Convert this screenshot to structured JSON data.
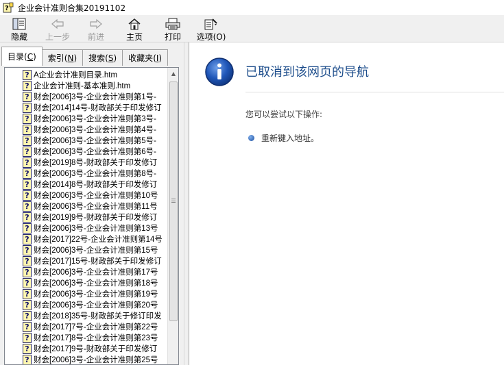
{
  "window": {
    "title": "企业会计准则合集20191102"
  },
  "toolbar": {
    "buttons": [
      {
        "label": "隐藏",
        "icon": "hide-pane-icon",
        "enabled": true
      },
      {
        "label": "上一步",
        "icon": "back-arrow-icon",
        "enabled": false
      },
      {
        "label": "前进",
        "icon": "forward-arrow-icon",
        "enabled": false
      },
      {
        "label": "主页",
        "icon": "home-icon",
        "enabled": true
      },
      {
        "label": "打印",
        "icon": "printer-icon",
        "enabled": true
      },
      {
        "label": "选项(O)",
        "icon": "options-icon",
        "enabled": true
      }
    ]
  },
  "tabs": [
    {
      "label": "目录",
      "key": "C"
    },
    {
      "label": "索引",
      "key": "N"
    },
    {
      "label": "搜索",
      "key": "S"
    },
    {
      "label": "收藏夹",
      "key": "I"
    }
  ],
  "tree": {
    "items": [
      "A企业会计准则目录.htm",
      "企业会计准则-基本准则.htm",
      "财会[2006]3号-企业会计准则第1号-",
      "财会[2014]14号-财政部关于印发修订",
      "财会[2006]3号-企业会计准则第3号-",
      "财会[2006]3号-企业会计准则第4号-",
      "财会[2006]3号-企业会计准则第5号-",
      "财会[2006]3号-企业会计准则第6号-",
      "财会[2019]8号-财政部关于印发修订",
      "财会[2006]3号-企业会计准则第8号-",
      "财会[2014]8号-财政部关于印发修订",
      "财会[2006]3号-企业会计准则第10号",
      "财会[2006]3号-企业会计准则第11号",
      "财会[2019]9号-财政部关于印发修订",
      "财会[2006]3号-企业会计准则第13号",
      "财会[2017]22号-企业会计准则第14号",
      "财会[2006]3号-企业会计准则第15号",
      "财会[2017]15号-财政部关于印发修订",
      "财会[2006]3号-企业会计准则第17号",
      "财会[2006]3号-企业会计准则第18号",
      "财会[2006]3号-企业会计准则第19号",
      "财会[2006]3号-企业会计准则第20号",
      "财会[2018]35号-财政部关于修订印发",
      "财会[2017]7号-企业会计准则第22号",
      "财会[2017]8号-企业会计准则第23号",
      "财会[2017]9号-财政部关于印发修订",
      "财会[2006]3号-企业会计准则第25号"
    ]
  },
  "content": {
    "heading": "已取消到该网页的导航",
    "subtext": "您可以尝试以下操作:",
    "bullet": "重新键入地址。"
  }
}
